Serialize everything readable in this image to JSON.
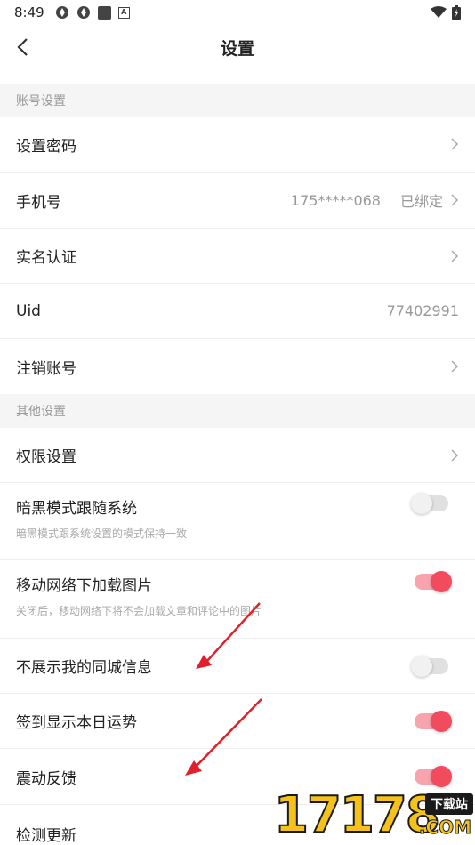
{
  "status_bar": {
    "time": "8:49"
  },
  "nav": {
    "title": "设置"
  },
  "sections": {
    "account": {
      "title": "账号设置"
    },
    "other": {
      "title": "其他设置"
    }
  },
  "account_rows": {
    "password": {
      "label": "设置密码"
    },
    "phone": {
      "label": "手机号",
      "value": "175*****068",
      "status": "已绑定"
    },
    "realname": {
      "label": "实名认证"
    },
    "uid": {
      "label": "Uid",
      "value": "77402991"
    },
    "cancel": {
      "label": "注销账号"
    }
  },
  "other_rows": {
    "permission": {
      "label": "权限设置"
    },
    "dark_mode": {
      "label": "暗黑模式跟随系统",
      "desc": "暗黑模式跟系统设置的模式保持一致",
      "enabled": false
    },
    "mobile_images": {
      "label": "移动网络下加载图片",
      "desc": "关闭后，移动网络下将不会加载文章和评论中的图片",
      "enabled": true
    },
    "local_info": {
      "label": "不展示我的同城信息",
      "enabled": false
    },
    "fortune": {
      "label": "签到显示本日运势",
      "enabled": true
    },
    "vibration": {
      "label": "震动反馈",
      "enabled": true
    },
    "update": {
      "label": "检测更新"
    }
  },
  "watermark": {
    "text": "17178",
    "badge": "下载站",
    "suffix": ".COM"
  },
  "colors": {
    "accent": "#f24b5e",
    "accent_track": "#f8a4ae",
    "section_bg": "#f5f5f5",
    "arrow": "#e0202a"
  }
}
